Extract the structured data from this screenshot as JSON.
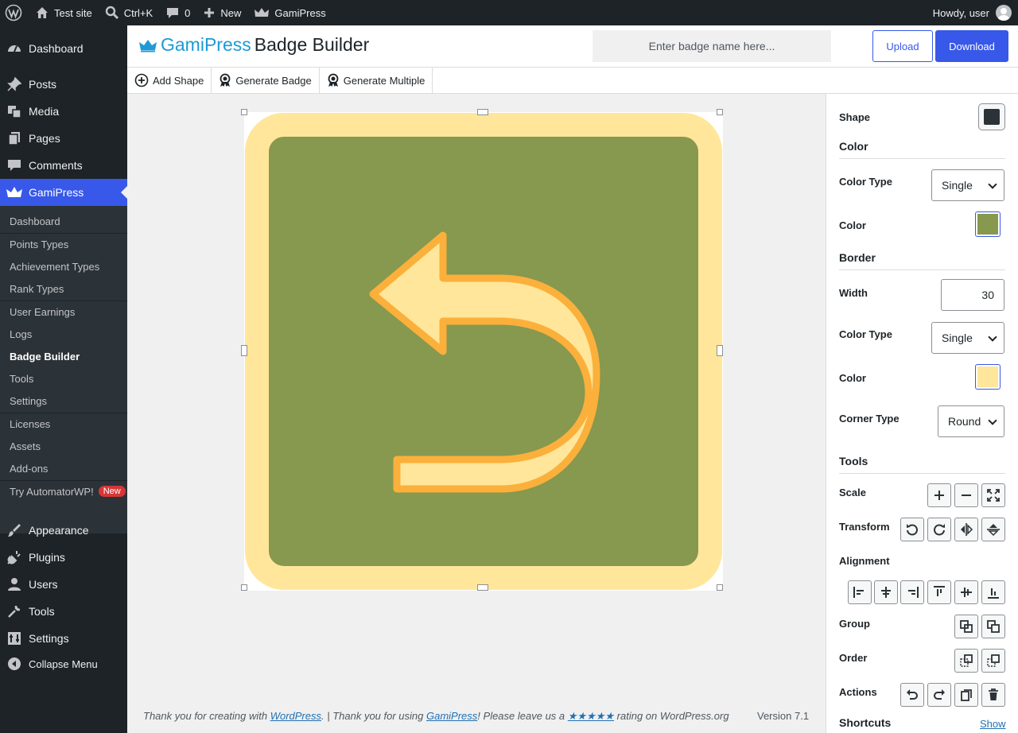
{
  "adminbar": {
    "site_name": "Test site",
    "search_shortcut": "Ctrl+K",
    "comments_count": "0",
    "new_label": "New",
    "plugin_label": "GamiPress",
    "howdy": "Howdy, user"
  },
  "sidebar": {
    "items": [
      {
        "label": "Dashboard",
        "icon": "dashboard-icon"
      },
      {
        "label": "Posts",
        "icon": "pin-icon"
      },
      {
        "label": "Media",
        "icon": "media-icon"
      },
      {
        "label": "Pages",
        "icon": "pages-icon"
      },
      {
        "label": "Comments",
        "icon": "comment-icon"
      },
      {
        "label": "GamiPress",
        "icon": "crown-icon"
      },
      {
        "label": "Appearance",
        "icon": "brush-icon"
      },
      {
        "label": "Plugins",
        "icon": "plug-icon"
      },
      {
        "label": "Users",
        "icon": "users-icon"
      },
      {
        "label": "Tools",
        "icon": "wrench-icon"
      },
      {
        "label": "Settings",
        "icon": "settings-icon"
      },
      {
        "label": "Collapse Menu",
        "icon": "collapse-icon"
      }
    ],
    "submenu": [
      "Dashboard",
      "Points Types",
      "Achievement Types",
      "Rank Types",
      "User Earnings",
      "Logs",
      "Badge Builder",
      "Tools",
      "Settings",
      "Licenses",
      "Assets",
      "Add-ons",
      "Try AutomatorWP!"
    ],
    "new_badge": "New"
  },
  "header": {
    "brand": "GamiPress",
    "title": "Badge Builder",
    "badge_name_placeholder": "Enter badge name here...",
    "upload_label": "Upload",
    "download_label": "Download"
  },
  "toolbar": {
    "add_shape": "Add Shape",
    "generate_badge": "Generate Badge",
    "generate_multiple": "Generate Multiple"
  },
  "canvas": {
    "badge_fill": "#87984f",
    "badge_border": "#ffe69a",
    "arrow_fill": "#ffe69a",
    "arrow_stroke": "#fbb03b"
  },
  "panel": {
    "shape_label": "Shape",
    "color_heading": "Color",
    "color_type_label": "Color Type",
    "color_type_value": "Single",
    "color_label": "Color",
    "color_value": "#87984f",
    "border_heading": "Border",
    "width_label": "Width",
    "width_value": "30",
    "border_color_type_label": "Color Type",
    "border_color_type_value": "Single",
    "border_color_label": "Color",
    "border_color_value": "#ffe69a",
    "corner_type_label": "Corner Type",
    "corner_type_value": "Round",
    "tools_heading": "Tools",
    "scale_label": "Scale",
    "transform_label": "Transform",
    "alignment_label": "Alignment",
    "group_label": "Group",
    "order_label": "Order",
    "actions_label": "Actions",
    "shortcuts_heading": "Shortcuts",
    "shortcuts_show": "Show"
  },
  "footer": {
    "thanks_prefix": "Thank you for creating with ",
    "wordpress_link": "WordPress",
    "thanks_mid": ". | Thank you for using ",
    "gamipress_link": "GamiPress",
    "thanks_leave": "! Please leave us a ",
    "stars": "★★★★★",
    "thanks_suffix": " rating on WordPress.org",
    "version": "Version 7.1"
  }
}
